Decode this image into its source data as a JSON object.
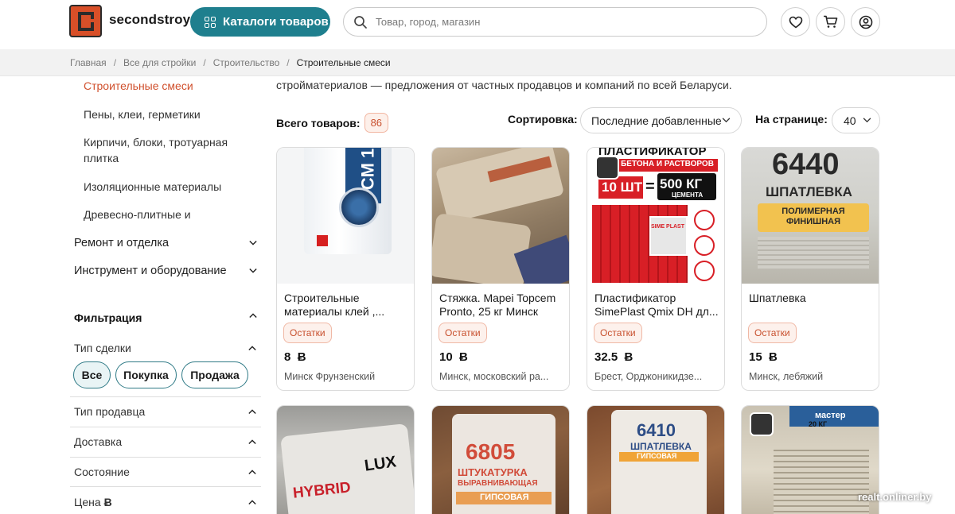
{
  "header": {
    "logo_text": "secondstroy",
    "catalog_button": "Каталоги товаров",
    "search_placeholder": "Товар, город, магазин"
  },
  "breadcrumb": [
    "Главная",
    "Все для стройки",
    "Строительство",
    "Строительные смеси"
  ],
  "sidebar": {
    "active_category": "Строительные смеси",
    "subcategories": [
      "Пены, клеи, герметики",
      "Кирпичи, блоки, тротуарная плитка",
      "Изоляционные материалы",
      "Древесно-плитные и"
    ],
    "top_categories": [
      "Ремонт и отделка",
      "Инструмент и оборудование"
    ],
    "filter_title": "Фильтрация",
    "deal_type_label": "Тип сделки",
    "deal_pills": [
      "Все",
      "Покупка",
      "Продажа"
    ],
    "filters": [
      "Тип продавца",
      "Доставка",
      "Состояние",
      "Цена"
    ],
    "currency_glyph": "Ƀ"
  },
  "main": {
    "intro": "стройматериалов — предложения от частных продавцов и компаний по всей Беларуси.",
    "total_label": "Всего товаров:",
    "total_count": "86",
    "sort_label": "Сортировка:",
    "sort_value": "Последние добавленные",
    "perpage_label": "На странице:",
    "perpage_value": "40"
  },
  "products": [
    {
      "title": "Строительные материалы клей ,...",
      "badge": "Остатки",
      "price": "8",
      "location": "Минск Фрунзенский"
    },
    {
      "title": "Стяжка. Mapei Topcem Pronto, 25 кг Минск",
      "badge": "Остатки",
      "price": "10",
      "location": "Минск, московский ра..."
    },
    {
      "title": "Пластификатор SimePlast Qmix DH дл...",
      "badge": "Остатки",
      "price": "32.5",
      "location": "Брест, Орджоникидзе..."
    },
    {
      "title": "Шпатлевка",
      "badge": "Остатки",
      "price": "15",
      "location": "Минск, лебяжий"
    }
  ],
  "image_texts": {
    "p1": "CM 1",
    "p3_top": "ПЛАСТИФИКАТОР",
    "p3_sub": "ДЛЯ БЕТОНА И РАСТВОРОВ",
    "p3_pcs": "10 ШТ",
    "p3_eq": "=",
    "p3_kg": "500 КГ",
    "p3_cement": "ЦЕМЕНТА",
    "p3_brand": "SIME PLAST",
    "p4_code": "6440",
    "p4_name": "ШПАТЛЕВКА",
    "p4_type": "ПОЛИМЕРНАЯ ФИНИШНАЯ",
    "p5_a": "HYBRID",
    "p5_b": "LUX",
    "p6_code": "6805",
    "p6_name": "ШТУКАТУРКА",
    "p6_sub": "ВЫРАВНИВАЮЩАЯ",
    "p6_type": "ГИПСОВАЯ",
    "p7_code": "6410",
    "p7_name": "ШПАТЛЕВКА",
    "p7_type": "ГИПСОВАЯ",
    "p8_a": "мастер",
    "p8_b": "20 КГ"
  },
  "watermark": "realt.onliner.by",
  "colors": {
    "accent": "#1f7f8e",
    "brand": "#d84f28",
    "badge": "#c8502e"
  }
}
